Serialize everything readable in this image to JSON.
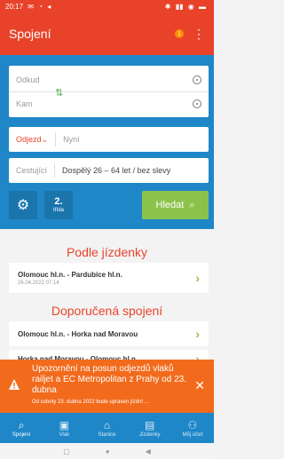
{
  "status": {
    "time": "20:17",
    "left_icons": [
      "✉",
      "◔",
      "◂"
    ],
    "right_icons": [
      "✱",
      "▮▮",
      "◉",
      "▬"
    ]
  },
  "app": {
    "title": "Spojení",
    "notif_count": "1",
    "menu": "⋮"
  },
  "search": {
    "from_label": "Odkud",
    "to_label": "Kam",
    "depart_label": "Odjezd",
    "depart_value": "Nyní",
    "travellers_label": "Cestující",
    "travellers_value": "Dospělý 26 – 64 let / bez slevy",
    "class_number": "2.",
    "class_label": "třída",
    "search_button": "Hledat"
  },
  "sections": {
    "by_ticket_title": "Podle jízdenky",
    "recommended_title": "Doporučená spojení"
  },
  "by_ticket": [
    {
      "route": "Olomouc hl.n. - Pardubice hl.n.",
      "date": "26.04.2022 07:14"
    }
  ],
  "recommended": [
    {
      "route": "Olomouc hl.n. - Horka nad Moravou"
    },
    {
      "route": "Horka nad Moravou - Olomouc hl.n."
    }
  ],
  "toast": {
    "message": "Upozornění na posun odjezdů vlaků railjet a EC Metropolitan z Prahy od 23. dubna",
    "details": "Od soboty 23. dubna 2022 bude upraven jízdní ..."
  },
  "nav": [
    {
      "icon": "search-icon",
      "glyph": "⌕",
      "label": "Spojení"
    },
    {
      "icon": "train-icon",
      "glyph": "▣",
      "label": "Vlak"
    },
    {
      "icon": "station-icon",
      "glyph": "⌂",
      "label": "Stanice"
    },
    {
      "icon": "ticket-icon",
      "glyph": "▤",
      "label": "Jízdenky"
    },
    {
      "icon": "account-icon",
      "glyph": "⚇",
      "label": "Můj účet"
    }
  ],
  "system_nav": [
    "▢",
    "●",
    "◀"
  ],
  "colors": {
    "primary": "#1f87c8",
    "accent": "#e8432a",
    "green": "#8bc34a",
    "toast": "#f26b1d"
  }
}
